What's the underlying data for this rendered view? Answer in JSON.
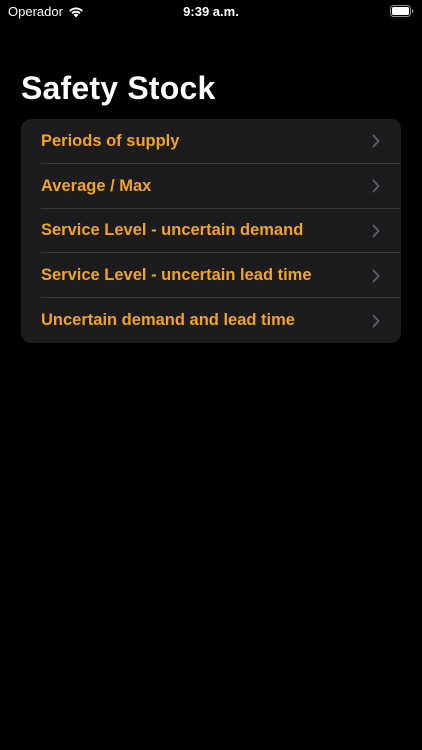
{
  "status_bar": {
    "carrier": "Operador",
    "time": "9:39 a.m."
  },
  "page": {
    "title": "Safety Stock"
  },
  "menu": {
    "items": [
      {
        "label": "Periods of supply",
        "icon": "chevron-right-icon"
      },
      {
        "label": "Average / Max",
        "icon": "chevron-right-icon"
      },
      {
        "label": "Service Level - uncertain demand",
        "icon": "chevron-right-icon"
      },
      {
        "label": "Service Level - uncertain lead time",
        "icon": "chevron-right-icon"
      },
      {
        "label": "Uncertain demand and lead time",
        "icon": "chevron-right-icon"
      }
    ]
  },
  "colors": {
    "background": "#000000",
    "card": "#1c1c1e",
    "accent": "#f0a329",
    "chevron": "#5b5b60",
    "separator": "#38383a"
  }
}
